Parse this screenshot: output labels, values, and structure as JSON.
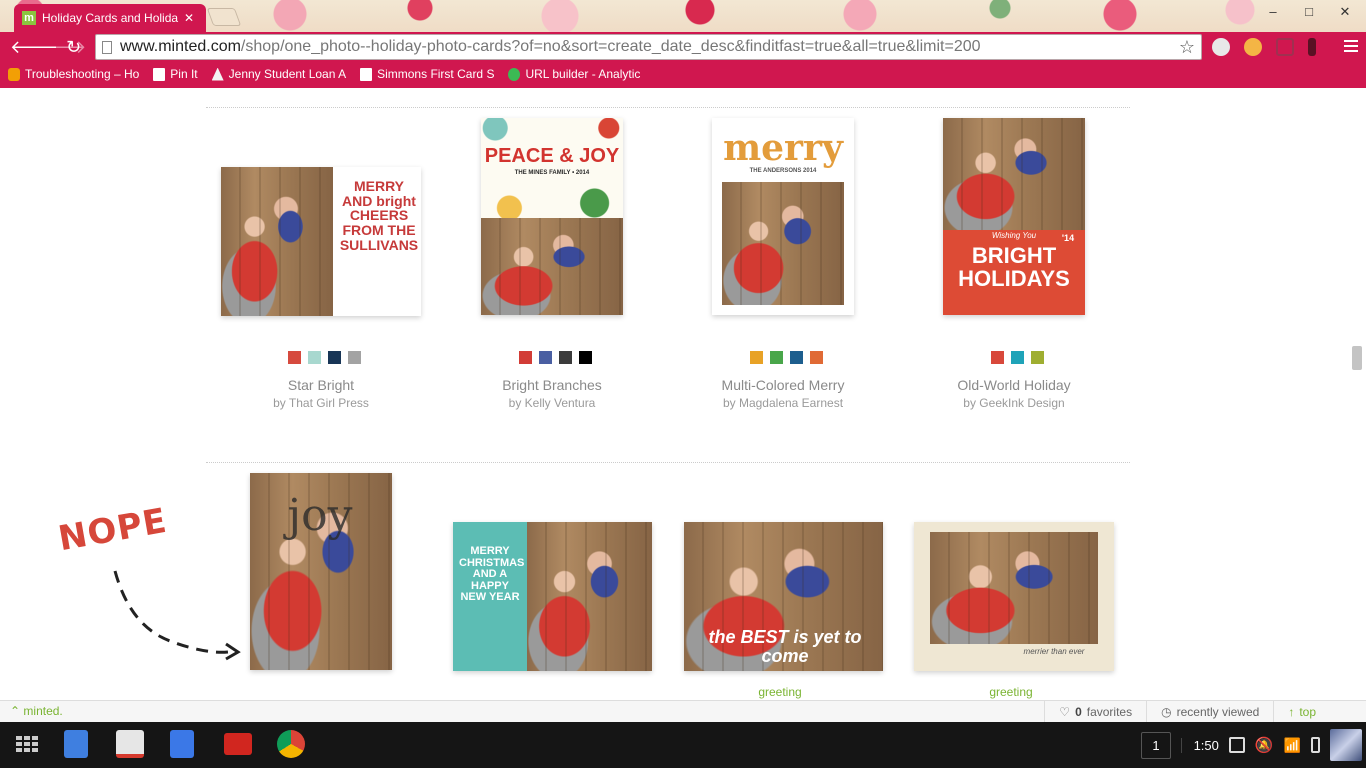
{
  "browser": {
    "tab_title": "Holiday Cards and Holida",
    "tab_favicon": "m",
    "tab_close": "✕",
    "url_host": "www.minted.com",
    "url_path": "/shop/one_photo--holiday-photo-cards?of=no&sort=create_date_desc&finditfast=true&all=true&limit=200",
    "bookmarks": [
      {
        "label": "Troubleshooting – Ho",
        "icon": "orange-app-icon"
      },
      {
        "label": "Pin It",
        "icon": "page-icon"
      },
      {
        "label": "Jenny Student Loan A",
        "icon": "triangle-icon"
      },
      {
        "label": "Simmons First Card S",
        "icon": "page-icon"
      },
      {
        "label": "URL builder - Analytic",
        "icon": "google-icon"
      }
    ]
  },
  "products": {
    "row1": [
      {
        "title": "Star Bright",
        "designer": "by That Girl Press",
        "swatches": [
          "#d64a3e",
          "#a8d8cf",
          "#183556",
          "#a3a3a3"
        ],
        "card_text": "MERRY AND bright CHEERS FROM THE SULLIVANS"
      },
      {
        "title": "Bright Branches",
        "designer": "by Kelly Ventura",
        "swatches": [
          "#d23c36",
          "#4a5fa2",
          "#3b3b3b",
          "#000000"
        ],
        "card_text": "PEACE & JOY",
        "card_subtext": "THE MINES FAMILY • 2014"
      },
      {
        "title": "Multi-Colored Merry",
        "designer": "by Magdalena Earnest",
        "swatches": [
          "#e8a226",
          "#49a64a",
          "#1d5e8e",
          "#e06a35"
        ],
        "card_text": "merry",
        "card_subtext": "THE ANDERSONS 2014"
      },
      {
        "title": "Old-World Holiday",
        "designer": "by GeekInk Design",
        "swatches": [
          "#d8483b",
          "#1fa3b8",
          "#9fae31"
        ],
        "card_text": "BRIGHT HOLIDAYS",
        "card_subtext": "Wishing You",
        "card_year": "'14"
      }
    ],
    "row2": [
      {
        "card_text": "joy"
      },
      {
        "card_text": "MERRY CHRISTMAS AND A HAPPY NEW YEAR"
      },
      {
        "card_text": "the BEST is yet to come",
        "tag": "greeting"
      },
      {
        "card_text": "merrier than ever",
        "tag": "greeting"
      }
    ]
  },
  "annotation": {
    "text": "NOPE"
  },
  "footer": {
    "brand": "minted.",
    "favorites_count": "0",
    "favorites_label": "favorites",
    "recently_viewed": "recently viewed",
    "top": "top"
  },
  "shelf": {
    "user_count": "1",
    "clock": "1:50"
  }
}
